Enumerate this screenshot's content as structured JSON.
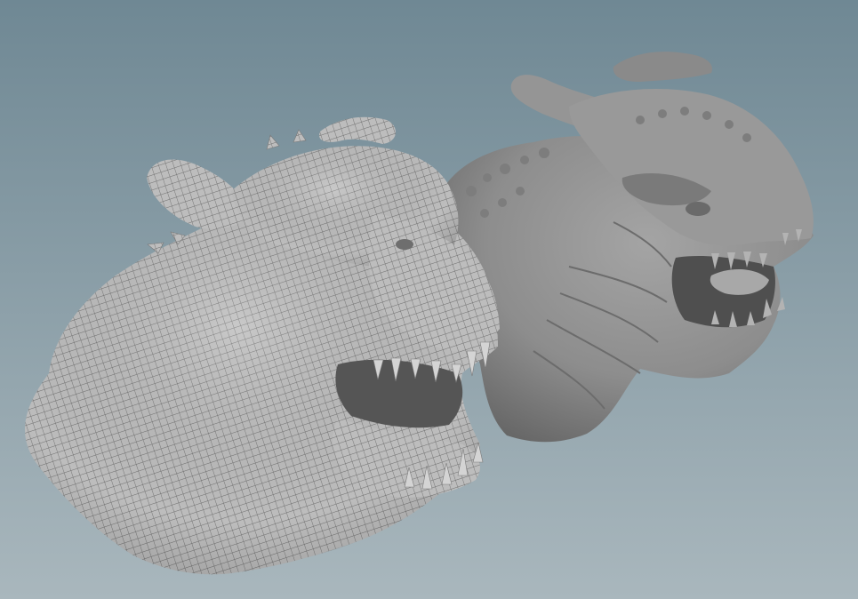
{
  "viewport": {
    "background_top": "#6f8894",
    "background_bottom": "#a9b7bd",
    "sculpt_fill": "#8d8d8d",
    "sculpt_shadow": "#5e5e5e",
    "wire_fill": "#bdbdbd",
    "wire_line": "#6e6e6e"
  },
  "models": [
    {
      "name": "wireframe-dragon-head",
      "shading": "wireframe-on-shaded"
    },
    {
      "name": "sculpted-dragon-head",
      "shading": "smooth-shaded"
    }
  ]
}
